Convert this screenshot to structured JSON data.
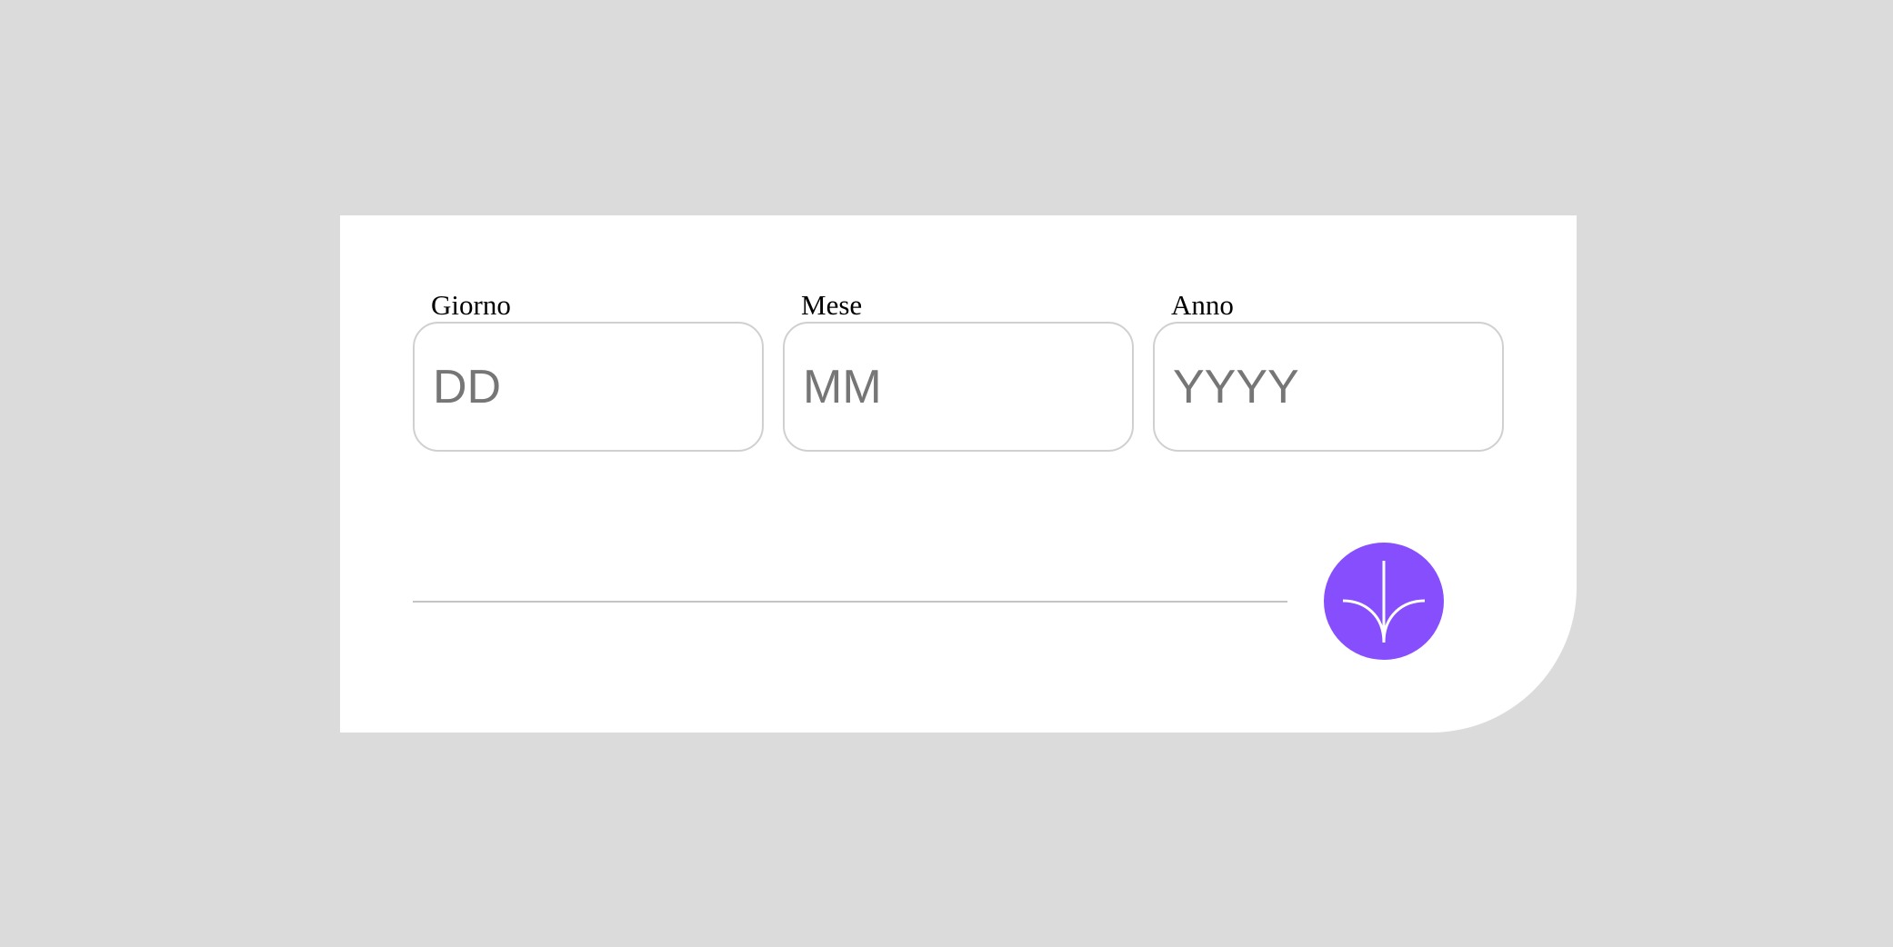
{
  "form": {
    "fields": [
      {
        "label": "Giorno",
        "placeholder": "DD",
        "value": ""
      },
      {
        "label": "Mese",
        "placeholder": "MM",
        "value": ""
      },
      {
        "label": "Anno",
        "placeholder": "YYYY",
        "value": ""
      }
    ],
    "submit": {
      "icon": "arrow-down-icon",
      "color": "#874efe"
    }
  },
  "colors": {
    "background": "#dbdbdb",
    "card": "#ffffff",
    "accent": "#874efe",
    "border": "#d0d0d0",
    "placeholder": "#767676"
  }
}
